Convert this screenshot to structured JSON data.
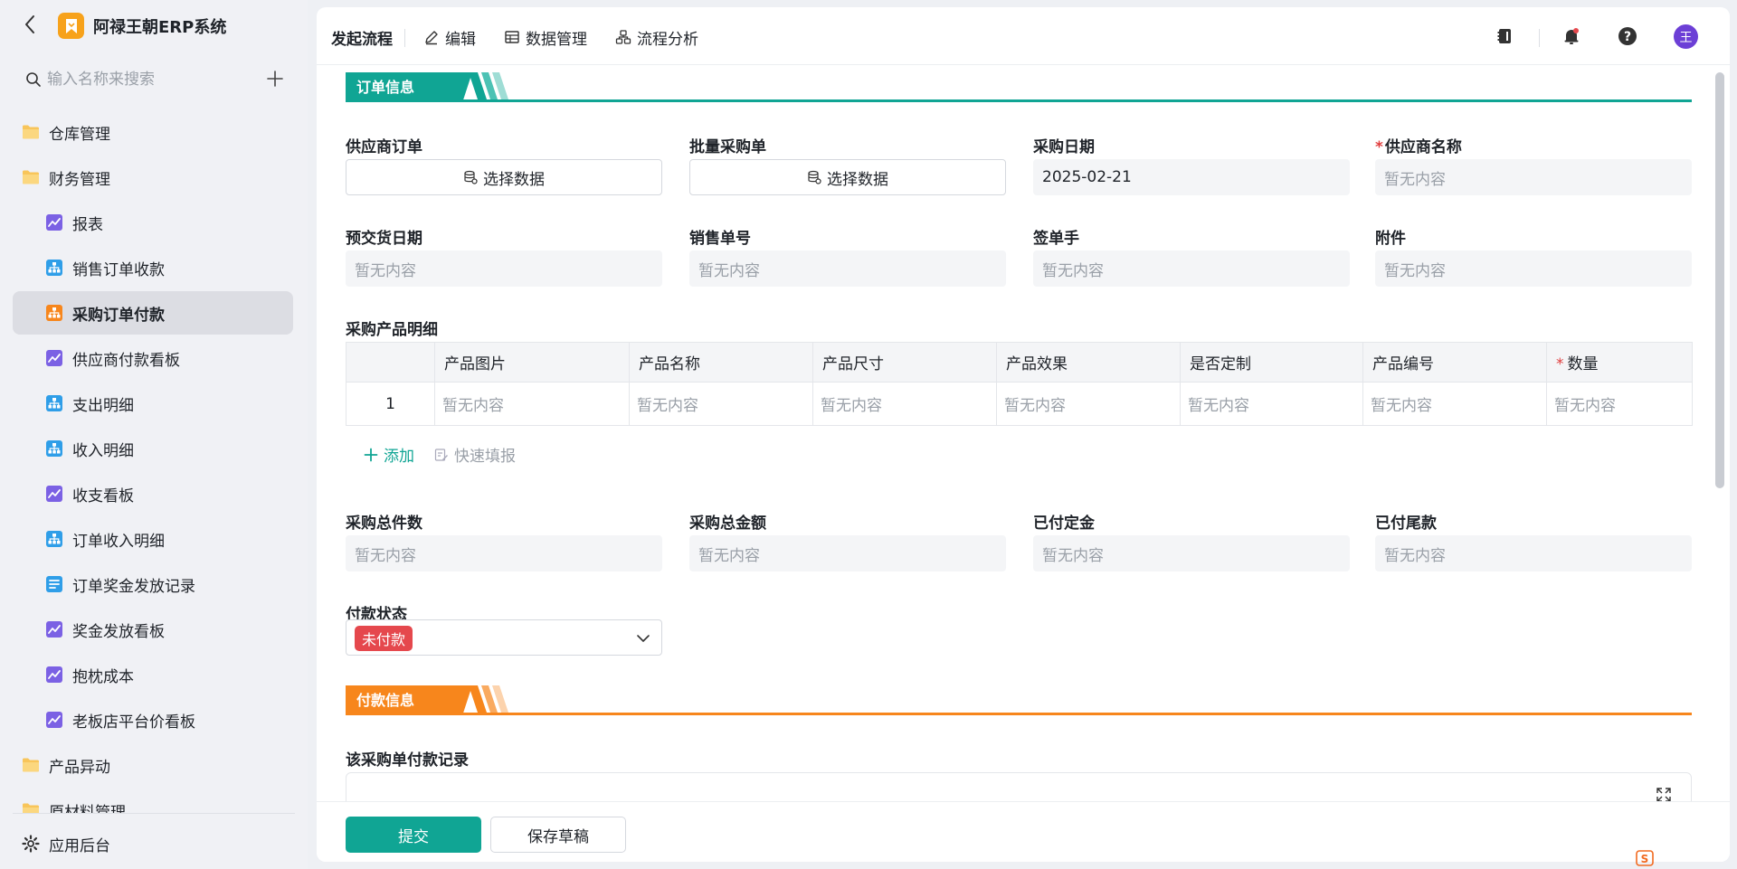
{
  "app": {
    "title": "阿禄王朝ERP系统"
  },
  "sidebar": {
    "search_placeholder": "输入名称来搜索",
    "items": [
      {
        "label": "仓库管理",
        "type": "folder"
      },
      {
        "label": "财务管理",
        "type": "folder"
      },
      {
        "label": "报表",
        "type": "chart"
      },
      {
        "label": "销售订单收款",
        "type": "form"
      },
      {
        "label": "采购订单付款",
        "type": "form",
        "active": true
      },
      {
        "label": "供应商付款看板",
        "type": "chart"
      },
      {
        "label": "支出明细",
        "type": "form"
      },
      {
        "label": "收入明细",
        "type": "form"
      },
      {
        "label": "收支看板",
        "type": "chart"
      },
      {
        "label": "订单收入明细",
        "type": "form"
      },
      {
        "label": "订单奖金发放记录",
        "type": "list"
      },
      {
        "label": "奖金发放看板",
        "type": "chart"
      },
      {
        "label": "抱枕成本",
        "type": "chart"
      },
      {
        "label": "老板店平台价看板",
        "type": "chart"
      },
      {
        "label": "产品异动",
        "type": "folder"
      },
      {
        "label": "原材料管理",
        "type": "folder"
      }
    ],
    "footer_label": "应用后台"
  },
  "topbar": {
    "tabs": [
      "发起流程",
      "编辑",
      "数据管理",
      "流程分析"
    ],
    "avatar_text": "王"
  },
  "form": {
    "section_order": "订单信息",
    "section_payment": "付款信息",
    "supplier_order": {
      "label": "供应商订单",
      "button": "选择数据"
    },
    "batch_purchase": {
      "label": "批量采购单",
      "button": "选择数据"
    },
    "purchase_date": {
      "label": "采购日期",
      "value": "2025-02-21"
    },
    "supplier_name": {
      "label": "供应商名称",
      "required": "*",
      "value": "暂无内容"
    },
    "delivery_date": {
      "label": "预交货日期",
      "value": "暂无内容"
    },
    "sales_no": {
      "label": "销售单号",
      "value": "暂无内容"
    },
    "signer": {
      "label": "签单手",
      "value": "暂无内容"
    },
    "attachment": {
      "label": "附件",
      "value": "暂无内容"
    },
    "detail_label": "采购产品明细",
    "table": {
      "columns": [
        "产品图片",
        "产品名称",
        "产品尺寸",
        "产品效果",
        "是否定制",
        "产品编号",
        "数量"
      ],
      "qty_required": "*",
      "rows": [
        {
          "index": "1",
          "cells": [
            "暂无内容",
            "暂无内容",
            "暂无内容",
            "暂无内容",
            "暂无内容",
            "暂无内容",
            "暂无内容"
          ]
        }
      ]
    },
    "add_label": "添加",
    "quick_fill_label": "快速填报",
    "total_qty": {
      "label": "采购总件数",
      "value": "暂无内容"
    },
    "total_amount": {
      "label": "采购总金额",
      "value": "暂无内容"
    },
    "deposit_paid": {
      "label": "已付定金",
      "value": "暂无内容"
    },
    "balance_paid": {
      "label": "已付尾款",
      "value": "暂无内容"
    },
    "payment_status": {
      "label": "付款状态",
      "value": "未付款"
    },
    "payment_records_label": "该采购单付款记录"
  },
  "footer": {
    "submit": "提交",
    "save_draft": "保存草稿"
  },
  "colors": {
    "accent": "#10a594",
    "orange": "#f7861c",
    "danger": "#e5484d"
  }
}
